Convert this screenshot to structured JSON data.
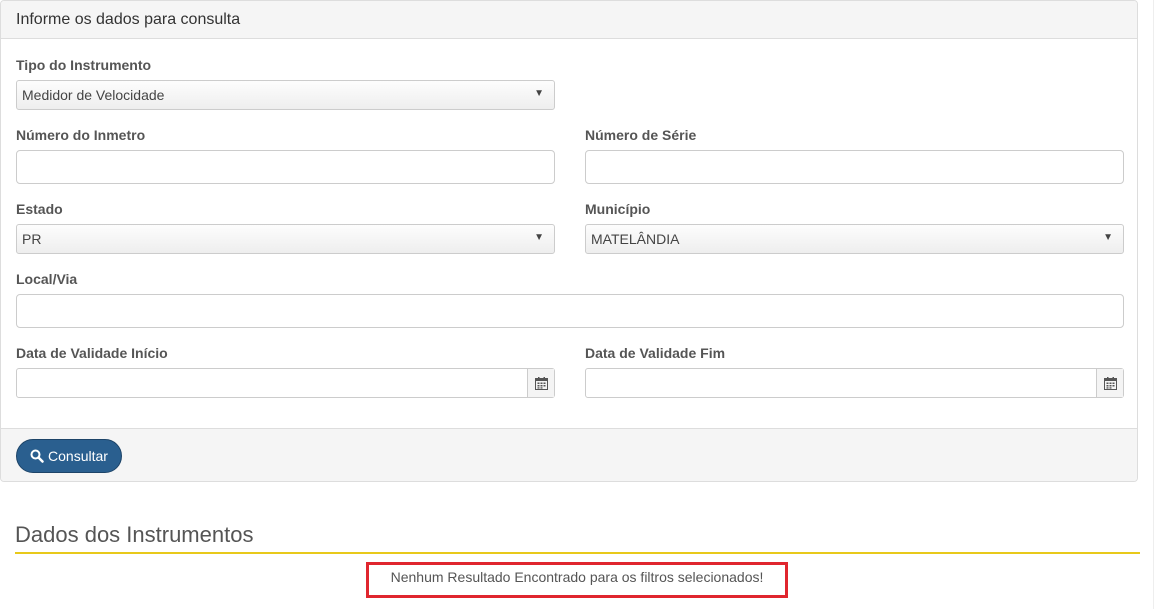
{
  "panel": {
    "heading": "Informe os dados para consulta"
  },
  "form": {
    "tipo_instrumento": {
      "label": "Tipo do Instrumento",
      "selected": "Medidor de Velocidade"
    },
    "numero_inmetro": {
      "label": "Número do Inmetro",
      "value": ""
    },
    "numero_serie": {
      "label": "Número de Série",
      "value": ""
    },
    "estado": {
      "label": "Estado",
      "selected": "PR"
    },
    "municipio": {
      "label": "Município",
      "selected": "MATELÂNDIA"
    },
    "local_via": {
      "label": "Local/Via",
      "value": ""
    },
    "data_inicio": {
      "label": "Data de Validade Início",
      "value": ""
    },
    "data_fim": {
      "label": "Data de Validade Fim",
      "value": ""
    },
    "submit_label": "Consultar"
  },
  "results": {
    "title": "Dados dos Instrumentos",
    "empty_message": "Nenhum Resultado Encontrado para os filtros selecionados!"
  },
  "icons": {
    "search": "search-icon",
    "calendar": "calendar-icon",
    "dropdown": "caret-down-icon"
  },
  "colors": {
    "primary_button": "#2a5f8f",
    "accent_rule": "#e8c91a",
    "highlight_border": "#e0262e"
  }
}
